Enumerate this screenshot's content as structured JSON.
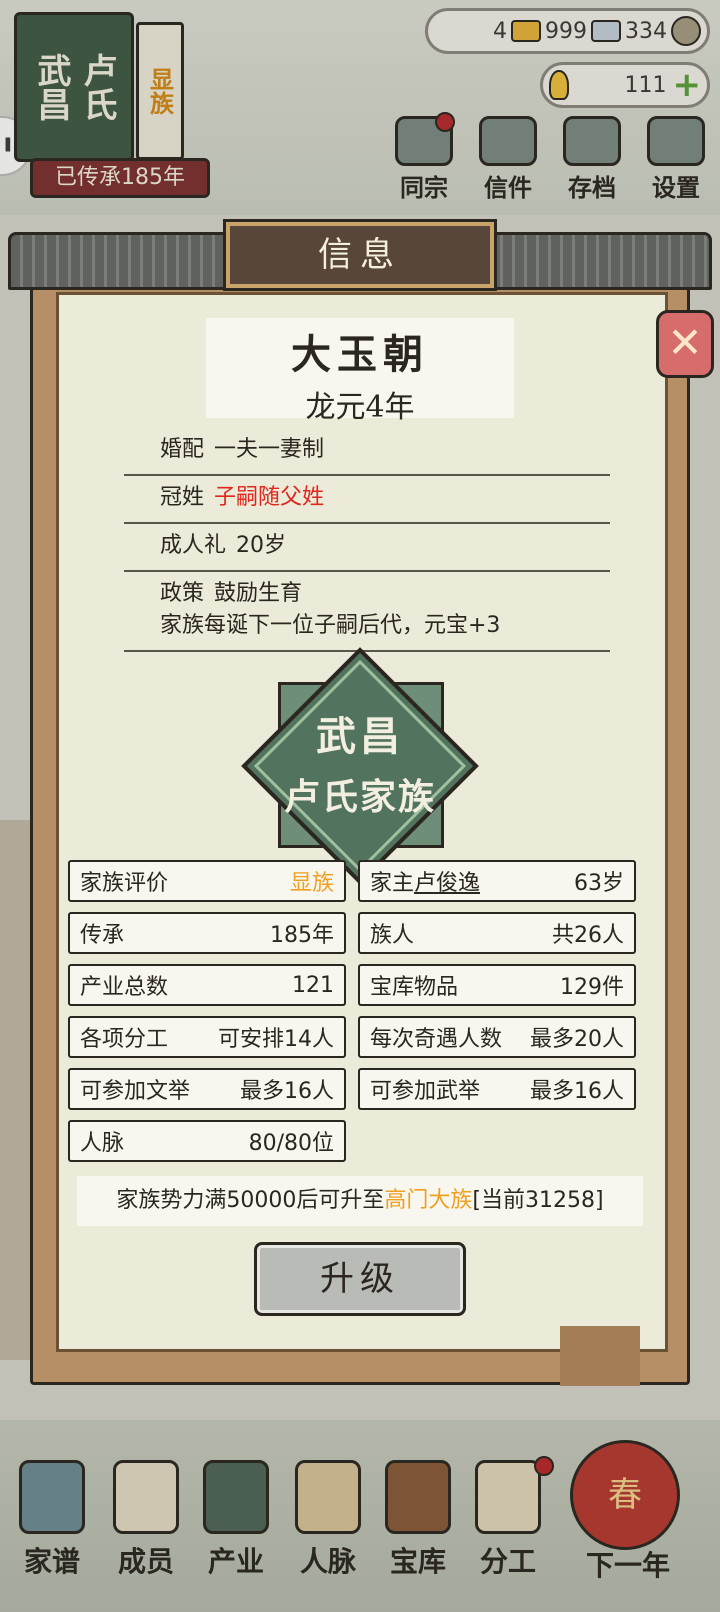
{
  "background": {
    "family_book": {
      "place": "武昌",
      "clan": "卢氏",
      "rank": "显族"
    },
    "inherit_text": "已传承185年",
    "currency": {
      "gold": "4",
      "silver": "999",
      "coin": "334",
      "yuanbao": "111"
    },
    "top_menu": [
      "同宗",
      "信件",
      "存档",
      "设置"
    ],
    "bottom_nav": [
      "家谱",
      "成员",
      "产业",
      "人脉",
      "宝库",
      "分工",
      "下一年"
    ],
    "lantern_char": "春"
  },
  "dialog": {
    "title": "信息",
    "era": {
      "name": "大玉朝",
      "year": "龙元4年"
    },
    "rules": {
      "marriage": {
        "label": "婚配",
        "value": "一夫一妻制"
      },
      "surname": {
        "label": "冠姓",
        "value": "子嗣随父姓"
      },
      "coming_of_age": {
        "label": "成人礼",
        "value": "20岁"
      },
      "policy": {
        "label": "政策",
        "value": "鼓励生育",
        "desc": "家族每诞下一位子嗣后代，元宝+3"
      }
    },
    "emblem": {
      "place": "武昌",
      "family": "卢氏家族"
    },
    "stats": {
      "rating": {
        "label": "家族评价",
        "value": "显族"
      },
      "head": {
        "label": "家主",
        "name": "卢俊逸",
        "age": "63岁"
      },
      "heritage": {
        "label": "传承",
        "value": "185年"
      },
      "members": {
        "label": "族人",
        "value": "共26人"
      },
      "industries": {
        "label": "产业总数",
        "value": "121"
      },
      "treasury": {
        "label": "宝库物品",
        "value": "129件"
      },
      "labor": {
        "label": "各项分工",
        "value": "可安排14人"
      },
      "encounter": {
        "label": "每次奇遇人数",
        "value": "最多20人"
      },
      "civil_exam": {
        "label": "可参加文举",
        "value": "最多16人"
      },
      "military_exam": {
        "label": "可参加武举",
        "value": "最多16人"
      },
      "connections": {
        "label": "人脉",
        "value": "80/80位"
      }
    },
    "notice": {
      "prefix": "家族势力满50000后可升至",
      "target": "高门大族",
      "suffix": "[当前31258]"
    },
    "upgrade_label": "升级"
  }
}
